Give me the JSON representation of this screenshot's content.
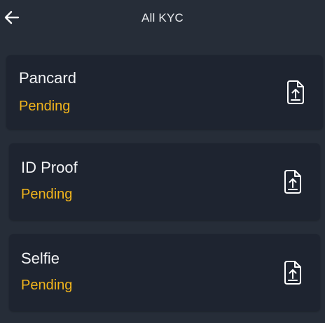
{
  "header": {
    "back_icon": "arrow-left-icon",
    "title": "All KYC"
  },
  "kyc_items": [
    {
      "label": "Pancard",
      "status": "Pending",
      "action_icon": "file-upload-icon"
    },
    {
      "label": "ID Proof",
      "status": "Pending",
      "action_icon": "file-upload-icon"
    },
    {
      "label": "Selfie",
      "status": "Pending",
      "action_icon": "file-upload-icon"
    }
  ],
  "colors": {
    "background": "#262d38",
    "card": "#1e2430",
    "status_pending": "#f2b51c",
    "text": "#f2f3f5"
  }
}
